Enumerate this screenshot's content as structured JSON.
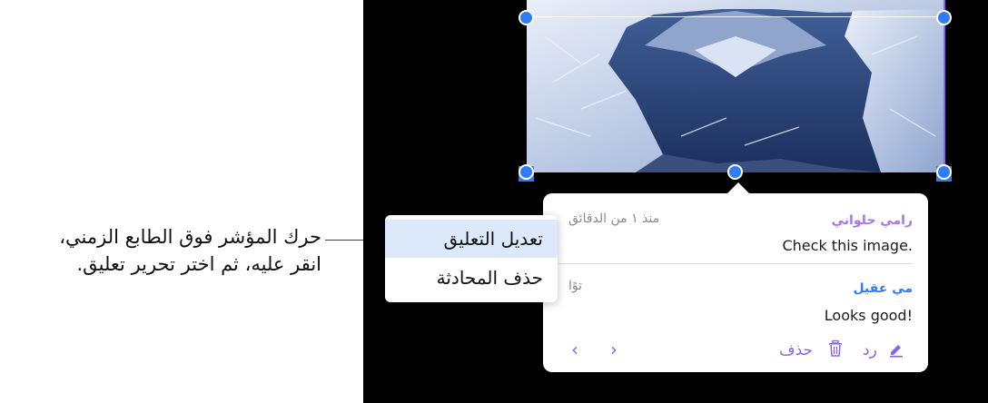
{
  "callout": {
    "line1": "حرك المؤشر فوق الطابع الزمني،",
    "line2": "انقر عليه، ثم اختر تحرير تعليق."
  },
  "context_menu": {
    "items": [
      {
        "label": "تعديل التعليق",
        "highlighted": true
      },
      {
        "label": "حذف المحادثة",
        "highlighted": false
      }
    ]
  },
  "comments": [
    {
      "author": "رامي حلواني",
      "time": "منذ ١ من الدقائق",
      "text": "Check this image.",
      "author_color": "#a874e8"
    },
    {
      "author": "مي عقيل",
      "time": "توًا",
      "text": "Looks good!",
      "author_color": "#2f7cf6"
    }
  ],
  "footer": {
    "reply_label": "رد",
    "delete_label": "حذف",
    "edit_icon": "pencil-icon",
    "delete_icon": "trash-icon",
    "prev_icon": "chevron-left-icon",
    "next_icon": "chevron-right-icon"
  },
  "colors": {
    "accent": "#8a63f0",
    "handle": "#2f7cf6",
    "menu_highlight": "#dbe9fb"
  }
}
